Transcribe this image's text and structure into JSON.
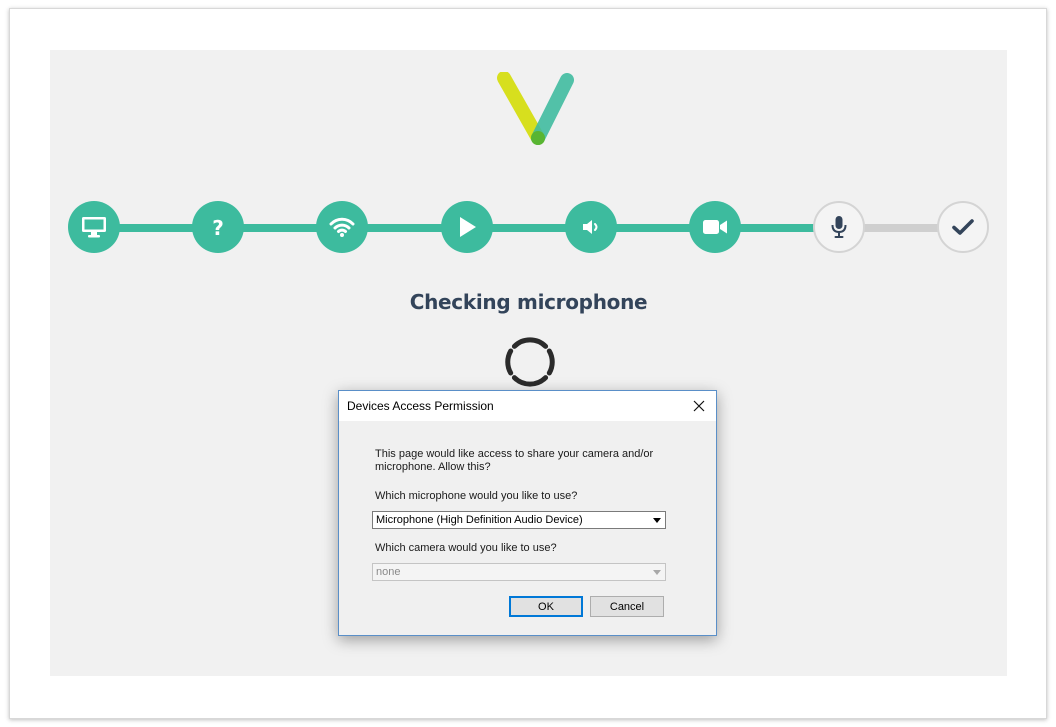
{
  "page": {
    "title": "Checking microphone",
    "accent_color": "#3dbb9e"
  },
  "steps": [
    {
      "icon": "monitor-icon",
      "state": "done"
    },
    {
      "icon": "question-icon",
      "state": "done"
    },
    {
      "icon": "wifi-icon",
      "state": "done"
    },
    {
      "icon": "play-icon",
      "state": "done"
    },
    {
      "icon": "speaker-icon",
      "state": "done"
    },
    {
      "icon": "video-camera-icon",
      "state": "done"
    },
    {
      "icon": "microphone-icon",
      "state": "current"
    },
    {
      "icon": "checkmark-icon",
      "state": "pending"
    }
  ],
  "dialog": {
    "title": "Devices Access Permission",
    "message": "This page would like access to share your camera and/or microphone. Allow this?",
    "microphone_label": "Which microphone would you like to use?",
    "microphone_value": "Microphone (High Definition Audio Device)",
    "camera_label": "Which camera would you like to use?",
    "camera_value": "none",
    "ok_label": "OK",
    "cancel_label": "Cancel"
  }
}
